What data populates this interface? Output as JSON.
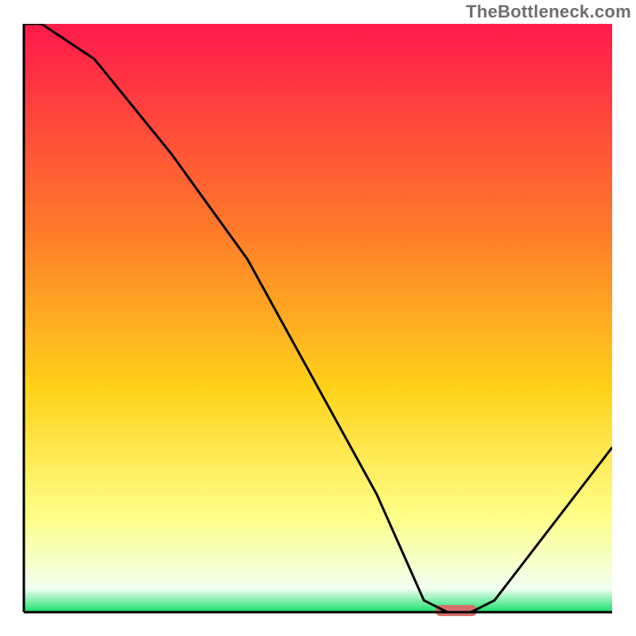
{
  "watermark": "TheBottleneck.com",
  "colors": {
    "axis": "#000000",
    "gradient_top": "#ff1a4b",
    "gradient_mid_upper": "#ff7a2a",
    "gradient_mid": "#ffd21a",
    "gradient_low": "#ffff8a",
    "gradient_base": "#f0fff0",
    "gradient_bottom": "#17e06c",
    "curve": "#000000",
    "marker": "#d66f6a"
  },
  "chart_data": {
    "type": "line",
    "title": "",
    "xlabel": "",
    "ylabel": "",
    "xlim": [
      0,
      100
    ],
    "ylim": [
      0,
      100
    ],
    "x": [
      0,
      3,
      12,
      25,
      38,
      60,
      68,
      72,
      76,
      80,
      100
    ],
    "values": [
      100,
      100,
      94,
      78,
      60,
      20,
      2,
      0,
      0,
      2,
      28
    ],
    "optimum_band": {
      "x_start": 70,
      "x_end": 77,
      "y": 0
    }
  }
}
